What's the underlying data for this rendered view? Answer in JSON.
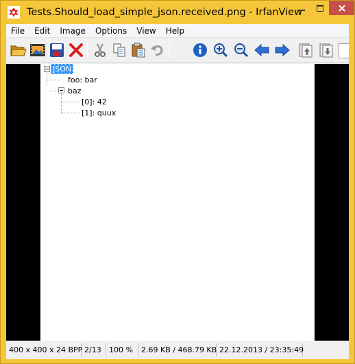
{
  "window": {
    "title": "Tests.Should_load_simple_json.received.png - IrfanView",
    "icons": {
      "app": "irfanview-icon",
      "minimize": "minimize-icon",
      "maximize": "maximize-icon",
      "close": "close-icon"
    }
  },
  "menubar": {
    "items": [
      "File",
      "Edit",
      "Image",
      "Options",
      "View",
      "Help"
    ]
  },
  "toolbar": {
    "buttons": [
      "open-folder-icon",
      "slideshow-icon",
      "save-icon",
      "delete-icon",
      "cut-icon",
      "copy-icon",
      "paste-icon",
      "undo-icon",
      "info-icon",
      "zoom-in-icon",
      "zoom-out-icon",
      "previous-arrow-icon",
      "next-arrow-icon",
      "first-page-icon",
      "last-page-icon"
    ]
  },
  "tree": {
    "root": "JSON",
    "nodes": [
      {
        "label": "foo: bar"
      },
      {
        "label": "baz",
        "children": [
          "[0]: 42",
          "[1]: quux"
        ]
      }
    ]
  },
  "statusbar": {
    "dimensions": "400 x 400 x 24 BPP",
    "page": "2/13",
    "zoom": "100 %",
    "size": "2.69 KB / 468.79 KB",
    "datetime": "22.12.2013 / 23:35:49"
  },
  "colors": {
    "titlebar": "#f6c63a",
    "close_button": "#c7504a",
    "selection": "#3399ff"
  }
}
